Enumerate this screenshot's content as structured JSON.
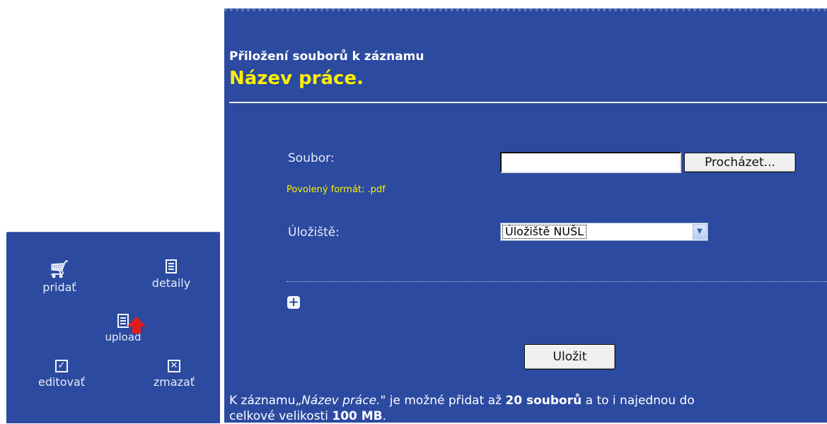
{
  "actions": {
    "add": {
      "label": "pridať",
      "icon": "cart-icon"
    },
    "details": {
      "label": "detaily",
      "icon": "document-icon"
    },
    "upload": {
      "label": "upload",
      "icon": "upload-icon"
    },
    "edit": {
      "label": "editovať",
      "icon": "edit-checkbox-icon"
    },
    "delete": {
      "label": "zmazať",
      "icon": "delete-x-icon"
    }
  },
  "form": {
    "subtitle": "Přiložení souborů k záznamu",
    "record_title": "Název práce.",
    "file_label": "Soubor:",
    "file_value": "",
    "browse_label": "Procházet...",
    "allowed_format": "Povolený formát: .pdf",
    "storage_label": "Úložiště:",
    "storage_selected": "Úložiště NUŠL",
    "add_more_label": "+",
    "save_label": "Uložit",
    "footer": {
      "part1": "K záznamu„",
      "record": "Název práce.",
      "part2": "\" je možné přidat až ",
      "count": "20 souborů",
      "part3": " a to i najednou do",
      "part4": "celkové velikosti ",
      "size": "100 MB",
      "part5": "."
    }
  },
  "colors": {
    "panel_bg": "#2b4aa0",
    "highlight_yellow": "#ffef00",
    "arrow_red": "#e31b1b"
  }
}
